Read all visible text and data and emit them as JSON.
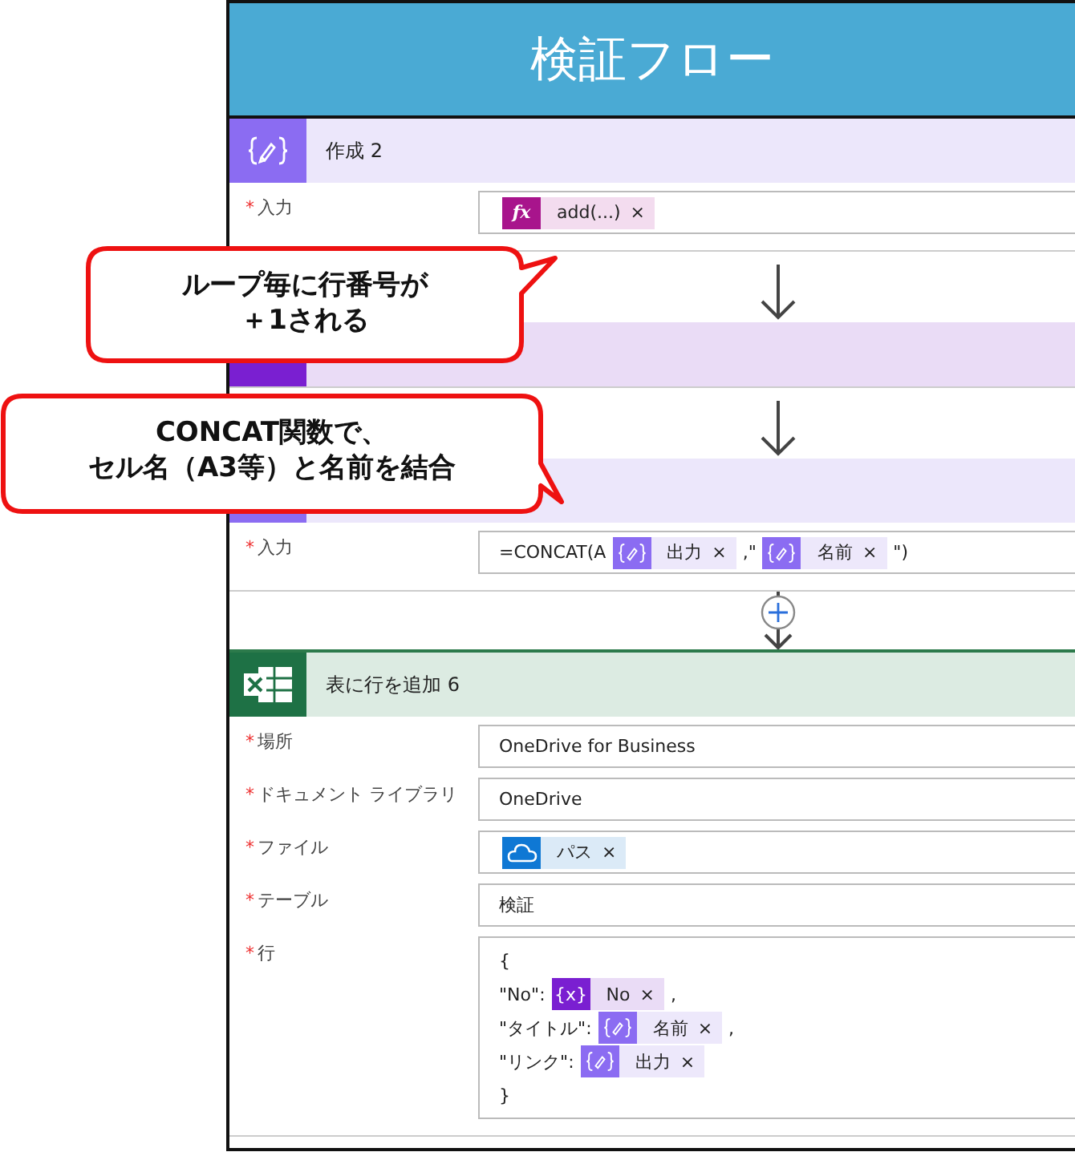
{
  "title": "検証フロー",
  "steps": [
    {
      "kind": "compose",
      "title": "作成 2",
      "fields": [
        {
          "mark": "*",
          "label": "入力",
          "lines": [
            [
              {
                "kind": "expression",
                "icon": "fx",
                "text": "add(...)",
                "close": "×"
              }
            ]
          ]
        }
      ]
    },
    {
      "kind": "variable"
    },
    {
      "kind": "compose",
      "fields": [
        {
          "mark": "*",
          "label": "入力",
          "lines": [
            [
              {
                "kind": "text",
                "text": "=CONCAT(A"
              },
              {
                "kind": "compose",
                "text": "出力",
                "close": "×"
              },
              {
                "kind": "text",
                "text": ",\""
              },
              {
                "kind": "compose",
                "text": "名前",
                "close": "×"
              },
              {
                "kind": "text",
                "text": "\")"
              }
            ]
          ]
        }
      ]
    },
    {
      "kind": "excel",
      "title": "表に行を追加 6",
      "fields": [
        {
          "mark": "*",
          "label": "場所",
          "lines": [
            [
              {
                "kind": "text",
                "text": "OneDrive for Business"
              }
            ]
          ]
        },
        {
          "mark": "*",
          "label": "ドキュメント ライブラリ",
          "lines": [
            [
              {
                "kind": "text",
                "text": "OneDrive"
              }
            ]
          ]
        },
        {
          "mark": "*",
          "label": "ファイル",
          "lines": [
            [
              {
                "kind": "onedrive",
                "text": "パス",
                "close": "×"
              }
            ]
          ]
        },
        {
          "mark": "*",
          "label": "テーブル",
          "lines": [
            [
              {
                "kind": "text",
                "text": "検証"
              }
            ]
          ]
        },
        {
          "mark": "*",
          "label": "行",
          "lines": [
            [
              {
                "kind": "text",
                "text": "{"
              }
            ],
            [
              {
                "kind": "text",
                "text": "\"No\":"
              },
              {
                "kind": "variable",
                "icon": "{x}",
                "text": "No",
                "close": "×"
              },
              {
                "kind": "text",
                "text": ","
              }
            ],
            [
              {
                "kind": "text",
                "text": "\"タイトル\":"
              },
              {
                "kind": "compose",
                "text": "名前",
                "close": "×"
              },
              {
                "kind": "text",
                "text": ","
              }
            ],
            [
              {
                "kind": "text",
                "text": "\"リンク\":"
              },
              {
                "kind": "compose",
                "text": "出力",
                "close": "×"
              }
            ],
            [
              {
                "kind": "text",
                "text": "}"
              }
            ]
          ]
        }
      ]
    }
  ],
  "connectors": [
    {
      "kind": "arrow"
    },
    {
      "kind": "arrow"
    },
    {
      "kind": "add"
    }
  ],
  "callouts": [
    {
      "lines": [
        "ループ毎に行番号が",
        "＋1される"
      ]
    },
    {
      "lines": [
        "CONCAT関数で、",
        "セル名（A3等）と名前を結合"
      ]
    }
  ]
}
